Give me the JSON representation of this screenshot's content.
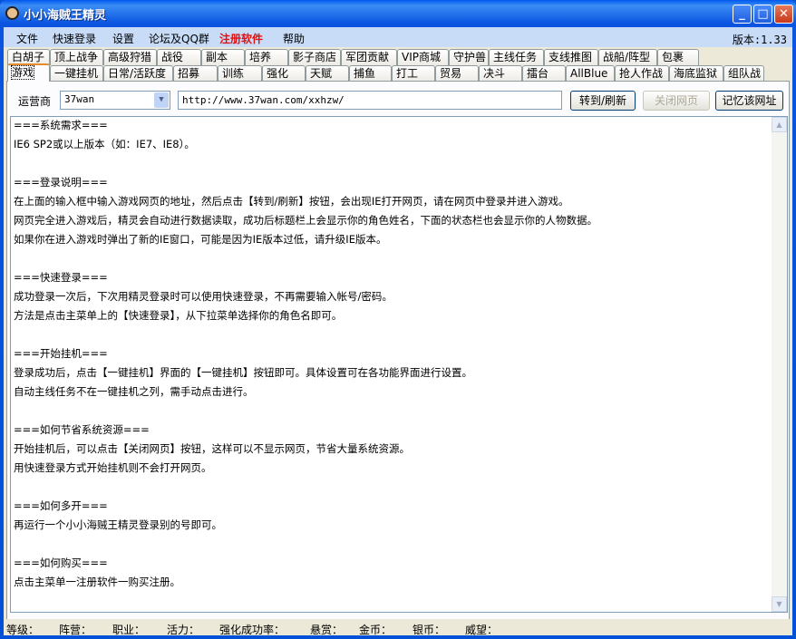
{
  "window": {
    "title": "小小海贼王精灵"
  },
  "menu": {
    "items": [
      "文件",
      "快速登录",
      "设置",
      "论坛及QQ群",
      "注册软件",
      "帮助"
    ],
    "version": "版本:1.33"
  },
  "tabs_row1": [
    "白胡子",
    "顶上战争",
    "高级狩猎",
    "战役",
    "副本",
    "培养",
    "影子商店",
    "军团贡献",
    "VIP商城",
    "守护兽",
    "主线任务",
    "支线推图",
    "战船/阵型",
    "包裹"
  ],
  "tabs_row2": [
    "游戏",
    "一键挂机",
    "日常/活跃度",
    "招募",
    "训练",
    "强化",
    "天赋",
    "捕鱼",
    "打工",
    "贸易",
    "决斗",
    "擂台",
    "AllBlue",
    "抢人作战",
    "海底监狱",
    "组队战"
  ],
  "toolbar": {
    "operator_label": "运营商",
    "operator_value": "37wan",
    "url": "http://www.37wan.com/xxhzw/",
    "goto_label": "转到/刷新",
    "close_label": "关闭网页",
    "remember_label": "记忆该网址"
  },
  "content": [
    "===系统需求===",
    "IE6 SP2或以上版本（如：IE7、IE8）。",
    "",
    "===登录说明===",
    "在上面的输入框中输入游戏网页的地址，然后点击【转到/刷新】按钮，会出现IE打开网页，请在网页中登录并进入游戏。",
    "网页完全进入游戏后，精灵会自动进行数据读取，成功后标题栏上会显示你的角色姓名，下面的状态栏也会显示你的人物数据。",
    "如果你在进入游戏时弹出了新的IE窗口，可能是因为IE版本过低，请升级IE版本。",
    "",
    "===快速登录===",
    "成功登录一次后，下次用精灵登录时可以使用快速登录，不再需要输入帐号/密码。",
    "方法是点击主菜单上的【快速登录】，从下拉菜单选择你的角色名即可。",
    "",
    "===开始挂机===",
    "登录成功后，点击【一键挂机】界面的【一键挂机】按钮即可。具体设置可在各功能界面进行设置。",
    "自动主线任务不在一键挂机之列，需手动点击进行。",
    "",
    "===如何节省系统资源===",
    "开始挂机后，可以点击【关闭网页】按钮，这样可以不显示网页，节省大量系统资源。",
    "用快速登录方式开始挂机则不会打开网页。",
    "",
    "===如何多开===",
    "再运行一个小小海贼王精灵登录别的号即可。",
    "",
    "===如何购买===",
    "点击主菜单一注册软件一购买注册。"
  ],
  "status": [
    "等级：",
    "阵营：",
    "职业：",
    "活力：",
    "强化成功率：",
    "悬赏：",
    "金币：",
    "银币：",
    "威望："
  ]
}
